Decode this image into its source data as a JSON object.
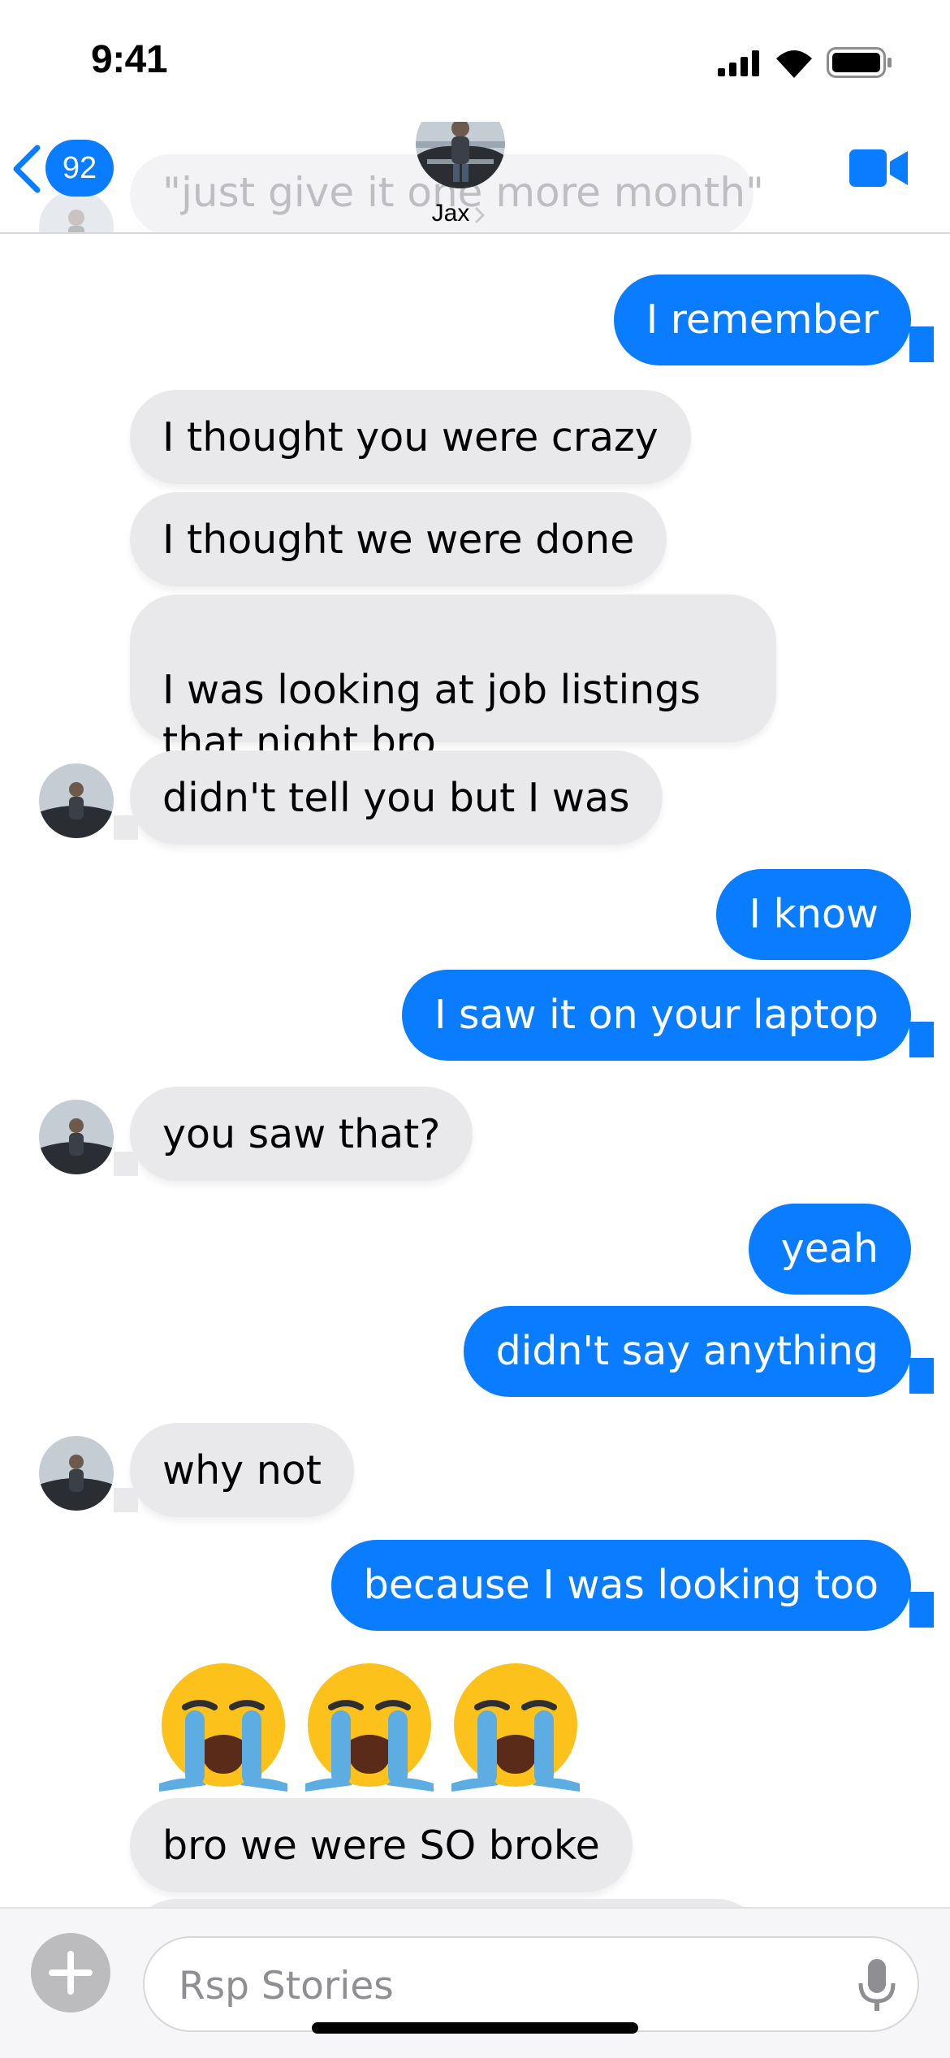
{
  "status_bar": {
    "time": "9:41"
  },
  "header": {
    "faded_message": "\"just give it one more month\"",
    "unread_count": "92",
    "contact_name": "Jax"
  },
  "messages": [
    {
      "side": "outgoing",
      "text": "I remember"
    },
    {
      "side": "incoming",
      "text": "I thought you were crazy"
    },
    {
      "side": "incoming",
      "text": "I thought we were done"
    },
    {
      "side": "incoming",
      "text": "I was looking at job listings\nthat night bro"
    },
    {
      "side": "incoming",
      "text": "didn't tell you but I was"
    },
    {
      "side": "outgoing",
      "text": "I know"
    },
    {
      "side": "outgoing",
      "text": "I saw it on your laptop"
    },
    {
      "side": "incoming",
      "text": "you saw that?"
    },
    {
      "side": "outgoing",
      "text": "yeah"
    },
    {
      "side": "outgoing",
      "text": "didn't say anything"
    },
    {
      "side": "incoming",
      "text": "why not"
    },
    {
      "side": "outgoing",
      "text": "because I was looking too"
    },
    {
      "side": "incoming",
      "emoji": [
        "loudly-crying-face",
        "loudly-crying-face",
        "loudly-crying-face"
      ]
    },
    {
      "side": "incoming",
      "text": "bro we were SO broke"
    }
  ],
  "composer": {
    "placeholder": "Rsp Stories"
  },
  "icons": {
    "back": "chevron-left-icon",
    "video": "video-camera-icon",
    "add": "plus-icon",
    "mic": "microphone-icon"
  },
  "colors": {
    "accent": "#0a7cff",
    "incoming_bubble": "#e9e9eb",
    "outgoing_text": "#ffffff"
  }
}
